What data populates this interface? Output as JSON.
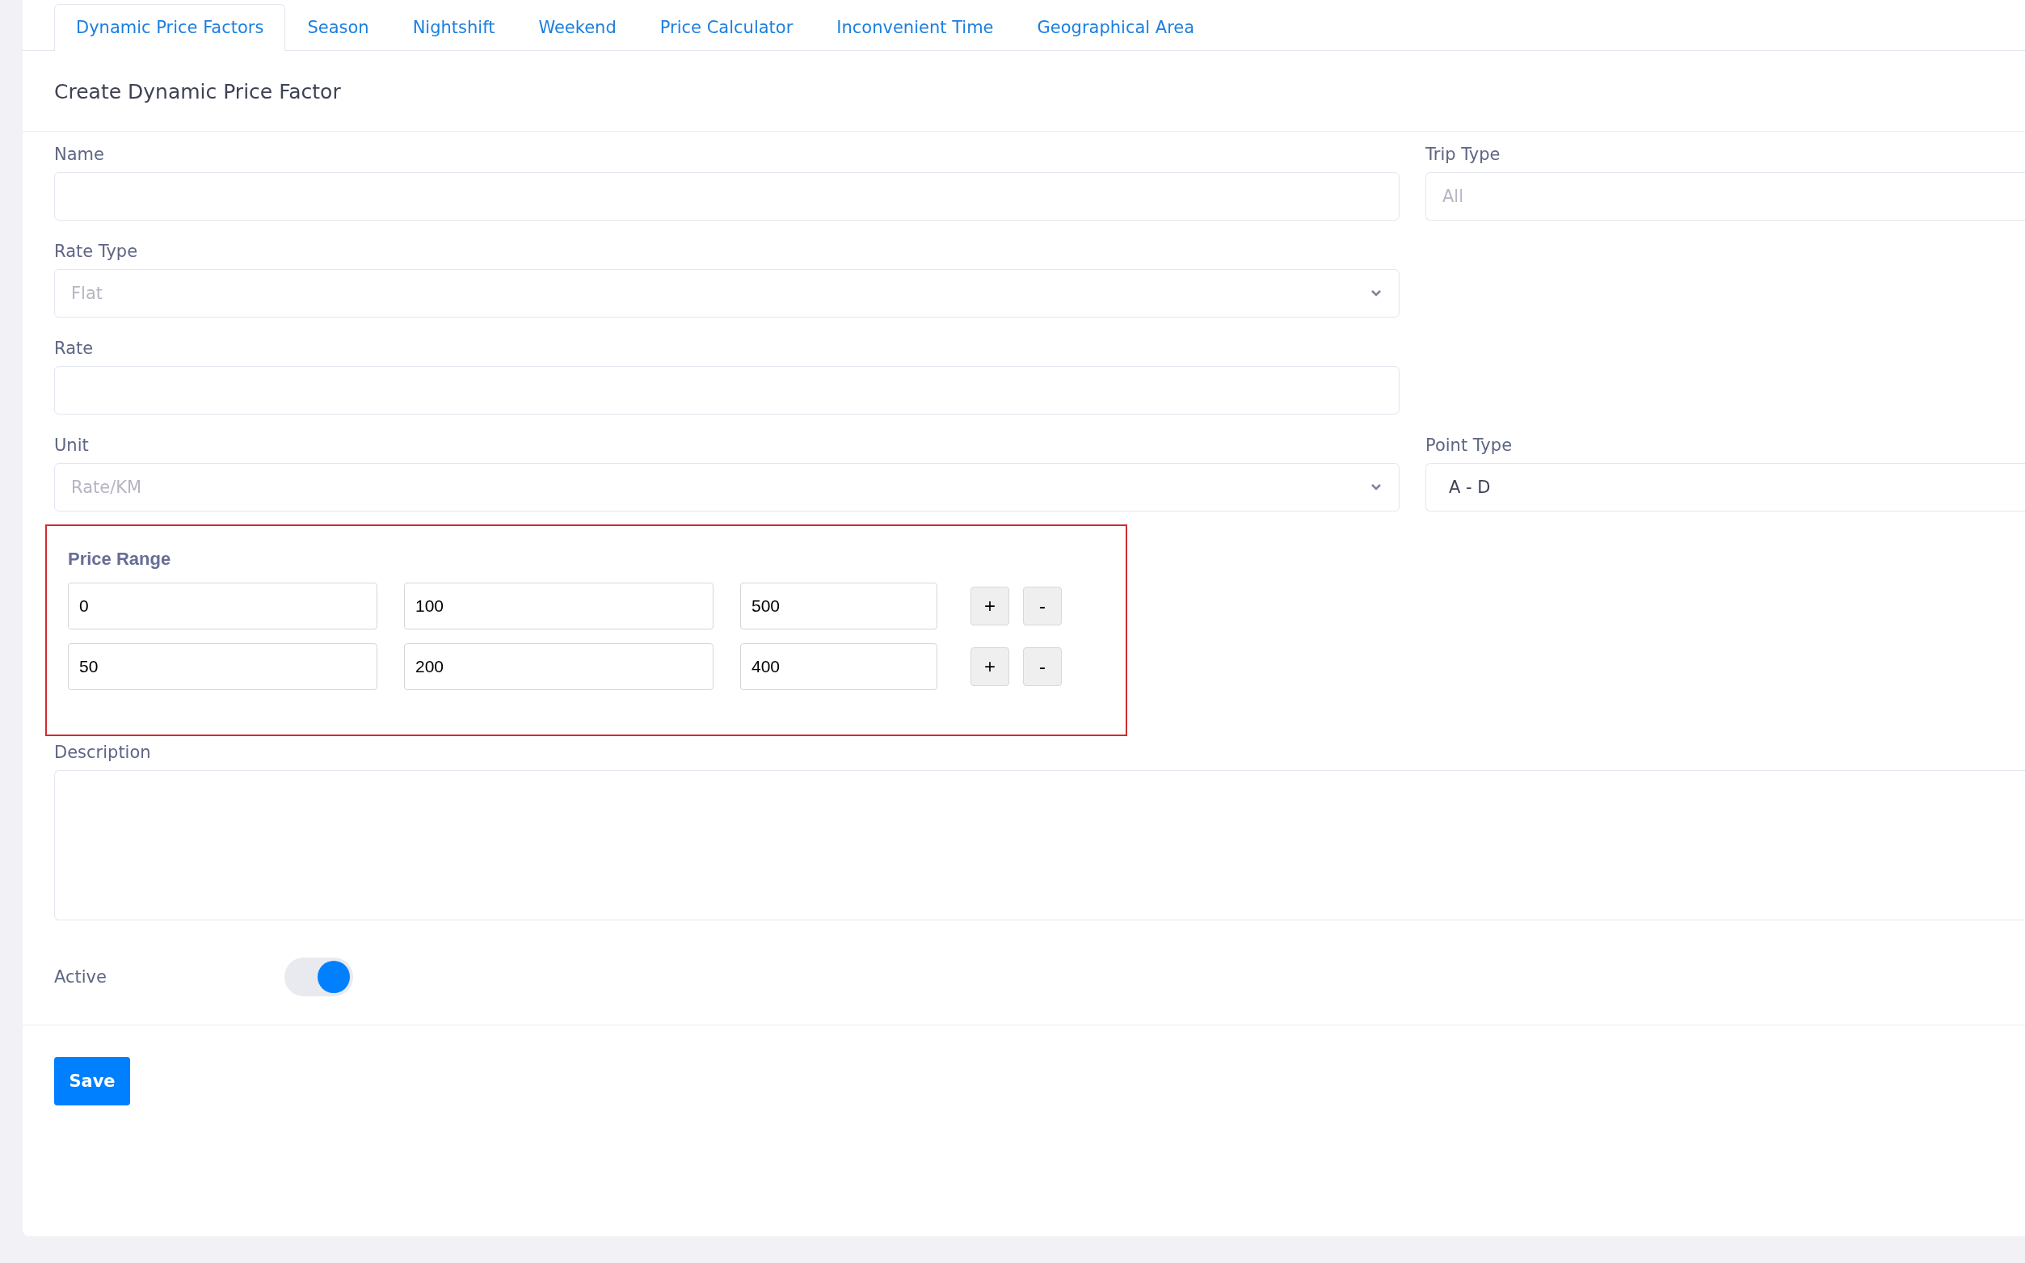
{
  "tabs": [
    {
      "label": "Dynamic Price Factors",
      "selected": true
    },
    {
      "label": "Season",
      "selected": false
    },
    {
      "label": "Nightshift",
      "selected": false
    },
    {
      "label": "Weekend",
      "selected": false
    },
    {
      "label": "Price Calculator",
      "selected": false
    },
    {
      "label": "Inconvenient Time",
      "selected": false
    },
    {
      "label": "Geographical Area",
      "selected": false
    }
  ],
  "heading": "Create Dynamic Price Factor",
  "form_rows": [
    {
      "left": {
        "label": "Name",
        "kind": "input"
      },
      "right": {
        "label": "Trip Type",
        "kind": "input",
        "placeholder": "All"
      }
    },
    {
      "left": {
        "label": "Rate Type",
        "kind": "select",
        "placeholder": "Flat"
      }
    },
    {
      "left": {
        "label": "Rate",
        "kind": "input"
      }
    },
    {
      "left": {
        "label": "Unit",
        "kind": "select",
        "placeholder": "Rate/KM"
      },
      "right": {
        "label": "Point Type",
        "kind": "input",
        "value": "A - D"
      }
    }
  ],
  "price_range": {
    "label": "Price Range",
    "rows": [
      {
        "values": [
          "0",
          "100",
          "500"
        ],
        "add": "+",
        "remove": "-"
      },
      {
        "values": [
          "50",
          "200",
          "400"
        ],
        "add": "+",
        "remove": "-"
      }
    ]
  },
  "description": {
    "label": "Description"
  },
  "active": {
    "label": "Active",
    "on": true
  },
  "save": "Save"
}
